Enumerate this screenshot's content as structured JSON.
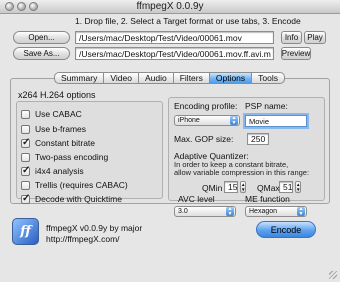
{
  "window": {
    "title": "ffmpegX 0.0.9y"
  },
  "hint": "1. Drop file, 2. Select a Target format or use tabs, 3. Encode",
  "open": {
    "button": "Open...",
    "path": "/Users/mac/Desktop/Test/Video/00061.mov",
    "info": "Info",
    "play": "Play"
  },
  "save": {
    "button": "Save As...",
    "path": "/Users/mac/Desktop/Test/Video/00061.mov.ff.avi.m",
    "preview": "Preview"
  },
  "tabs": [
    "Summary",
    "Video",
    "Audio",
    "Filters",
    "Options",
    "Tools"
  ],
  "active_tab": "Options",
  "options": {
    "section_title": "x264 H.264 options",
    "checkboxes": [
      {
        "label": "Use CABAC",
        "checked": false
      },
      {
        "label": "Use b-frames",
        "checked": false
      },
      {
        "label": "Constant bitrate",
        "checked": true
      },
      {
        "label": "Two-pass encoding",
        "checked": false
      },
      {
        "label": "i4x4 analysis",
        "checked": true
      },
      {
        "label": "Trellis (requires CABAC)",
        "checked": false
      },
      {
        "label": "Decode with Quicktime",
        "checked": true
      }
    ],
    "encoding_profile_label": "Encoding profile:",
    "encoding_profile_value": "iPhone",
    "psp_name_label": "PSP name:",
    "psp_name_value": "Movie",
    "gop_label": "Max. GOP size:",
    "gop_value": "250",
    "aq_title": "Adaptive Quantizer:",
    "aq_desc_1": "In order to keep a constant bitrate,",
    "aq_desc_2": "allow variable compression in this range:",
    "qmin_label": "QMin",
    "qmin_value": "15",
    "qmax_label": "QMax",
    "qmax_value": "51",
    "avc_label": "AVC level",
    "avc_value": "3.0",
    "me_label": "ME function",
    "me_value": "Hexagon"
  },
  "footer": {
    "line1": "ffmpegX v0.0.9y by major",
    "line2": "http://ffmpegX.com/",
    "encode": "Encode"
  }
}
